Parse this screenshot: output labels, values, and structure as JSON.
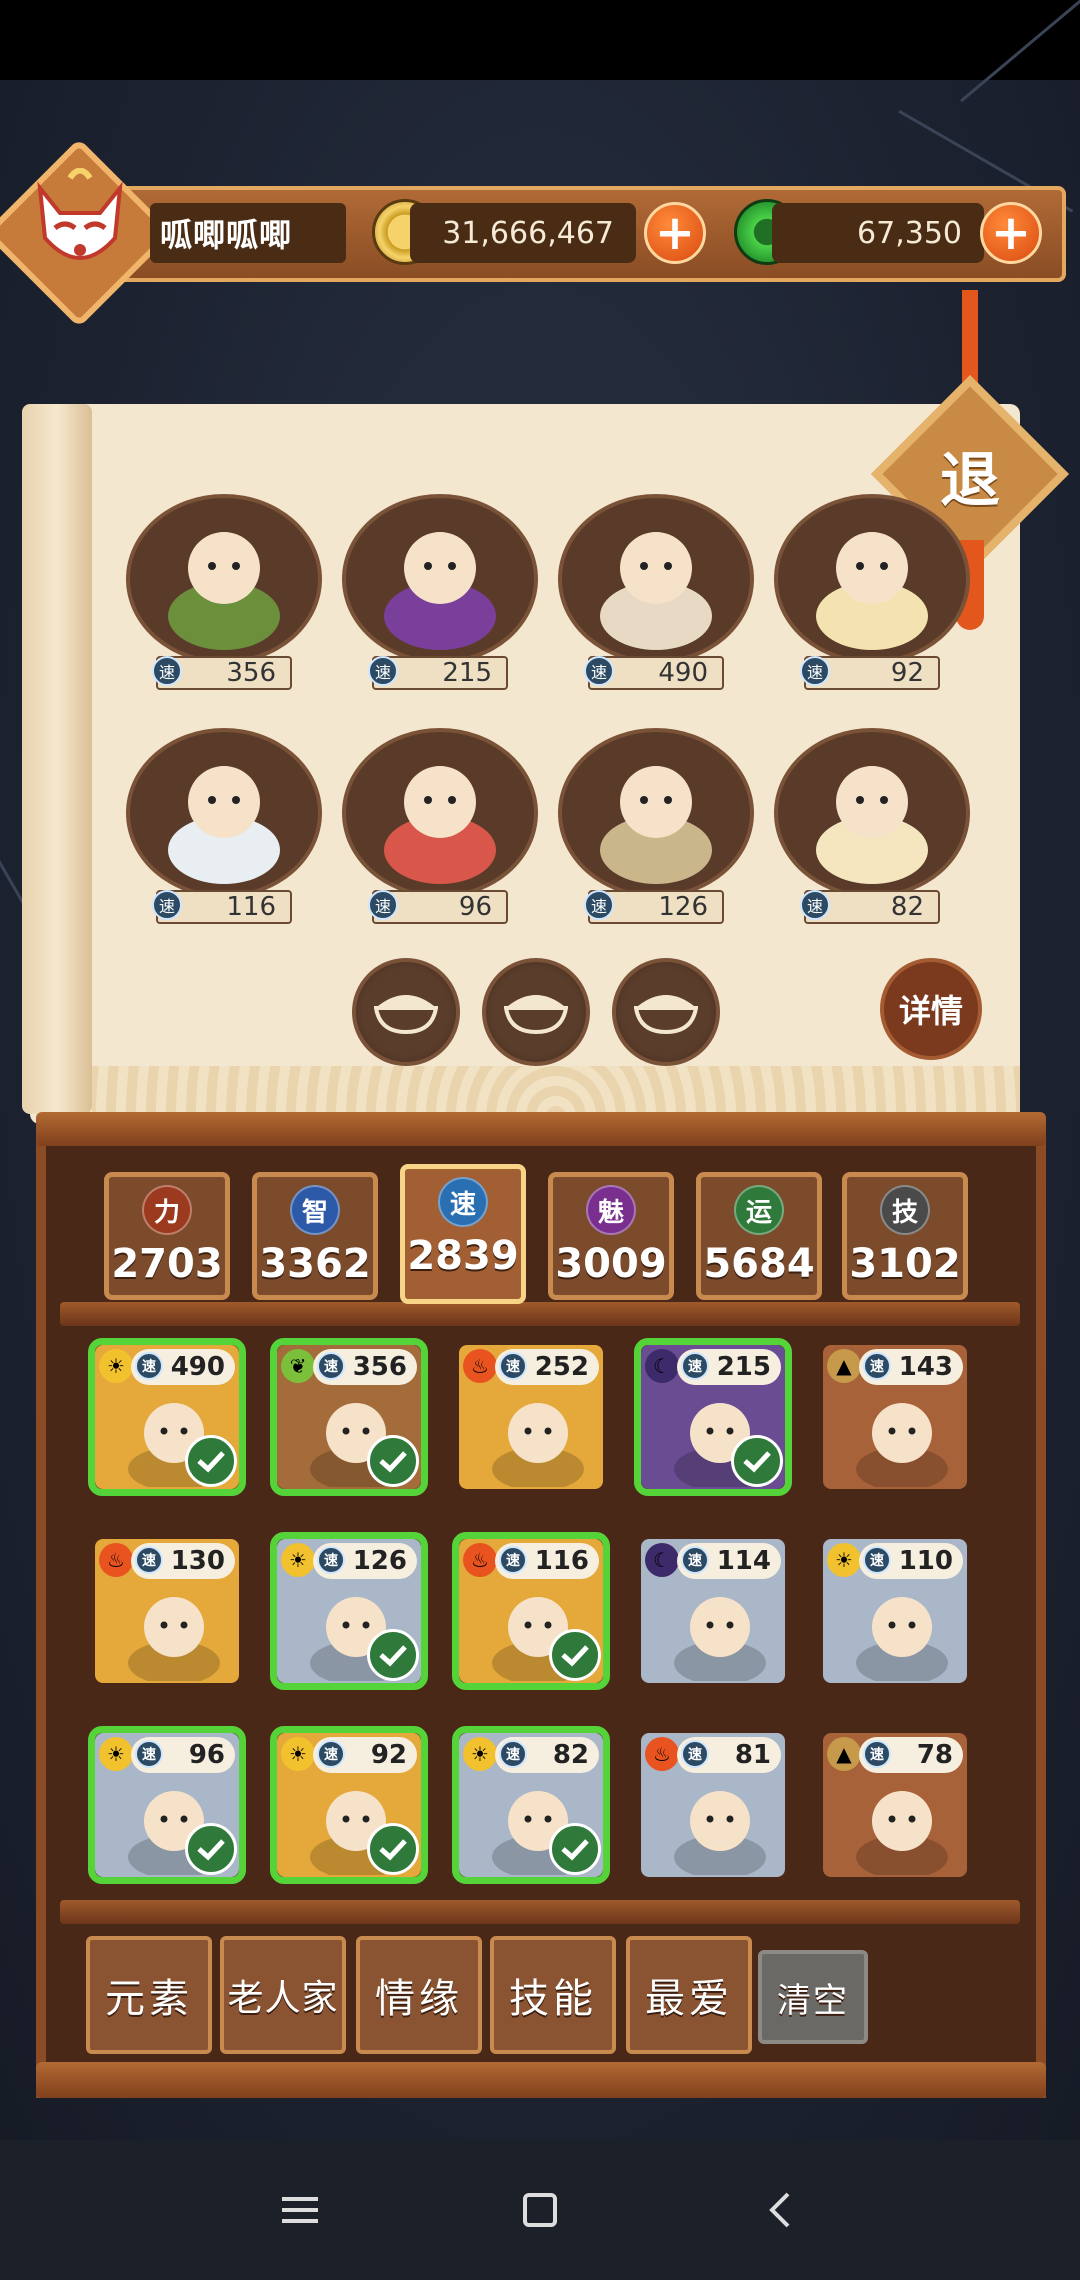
{
  "player": {
    "name": "呱唧呱唧",
    "gold": "31,666,467",
    "jade": "67,350"
  },
  "exit_label": "退",
  "detail_label": "详情",
  "speed_label": "速",
  "team": [
    {
      "speed": "356",
      "hero": "forest-warrior"
    },
    {
      "speed": "215",
      "hero": "purple-empress"
    },
    {
      "speed": "490",
      "hero": "ghost-family"
    },
    {
      "speed": "92",
      "hero": "gourd-sage"
    },
    {
      "speed": "116",
      "hero": "mahjong-tile"
    },
    {
      "speed": "96",
      "hero": "pig-king"
    },
    {
      "speed": "126",
      "hero": "coin-monk"
    },
    {
      "speed": "82",
      "hero": "lotus-buddha"
    }
  ],
  "stats": [
    {
      "icon": "力",
      "value": "2703",
      "color": "#9b3a1e"
    },
    {
      "icon": "智",
      "value": "3362",
      "color": "#2d5aa8"
    },
    {
      "icon": "速",
      "value": "2839",
      "color": "#2b6fb3"
    },
    {
      "icon": "魅",
      "value": "3009",
      "color": "#7a2f8f"
    },
    {
      "icon": "运",
      "value": "5684",
      "color": "#2f7a3b"
    },
    {
      "icon": "技",
      "value": "3102",
      "color": "#4a4a4a"
    }
  ],
  "cards": [
    {
      "speed": "490",
      "selected": true,
      "element": "sun",
      "bg": "#e5a93b"
    },
    {
      "speed": "356",
      "selected": true,
      "element": "leaf",
      "bg": "#a36c3a"
    },
    {
      "speed": "252",
      "selected": false,
      "element": "fire",
      "bg": "#e5a93b"
    },
    {
      "speed": "215",
      "selected": true,
      "element": "moon",
      "bg": "#6a4c92"
    },
    {
      "speed": "143",
      "selected": false,
      "element": "earth",
      "bg": "#a8623a"
    },
    {
      "speed": "130",
      "selected": false,
      "element": "fire",
      "bg": "#e5a93b"
    },
    {
      "speed": "126",
      "selected": true,
      "element": "sun",
      "bg": "#a9b7c8"
    },
    {
      "speed": "116",
      "selected": true,
      "element": "fire",
      "bg": "#e5a93b"
    },
    {
      "speed": "114",
      "selected": false,
      "element": "moon",
      "bg": "#a9b7c8"
    },
    {
      "speed": "110",
      "selected": false,
      "element": "sun",
      "bg": "#a9b7c8"
    },
    {
      "speed": "96",
      "selected": true,
      "element": "sun",
      "bg": "#a9b7c8"
    },
    {
      "speed": "92",
      "selected": true,
      "element": "sun",
      "bg": "#e5a93b"
    },
    {
      "speed": "82",
      "selected": true,
      "element": "sun",
      "bg": "#a9b7c8"
    },
    {
      "speed": "81",
      "selected": false,
      "element": "fire",
      "bg": "#a9b7c8"
    },
    {
      "speed": "78",
      "selected": false,
      "element": "earth",
      "bg": "#a8623a"
    }
  ],
  "filters": [
    "元素",
    "老人家",
    "情缘",
    "技能",
    "最爱",
    "清空"
  ]
}
